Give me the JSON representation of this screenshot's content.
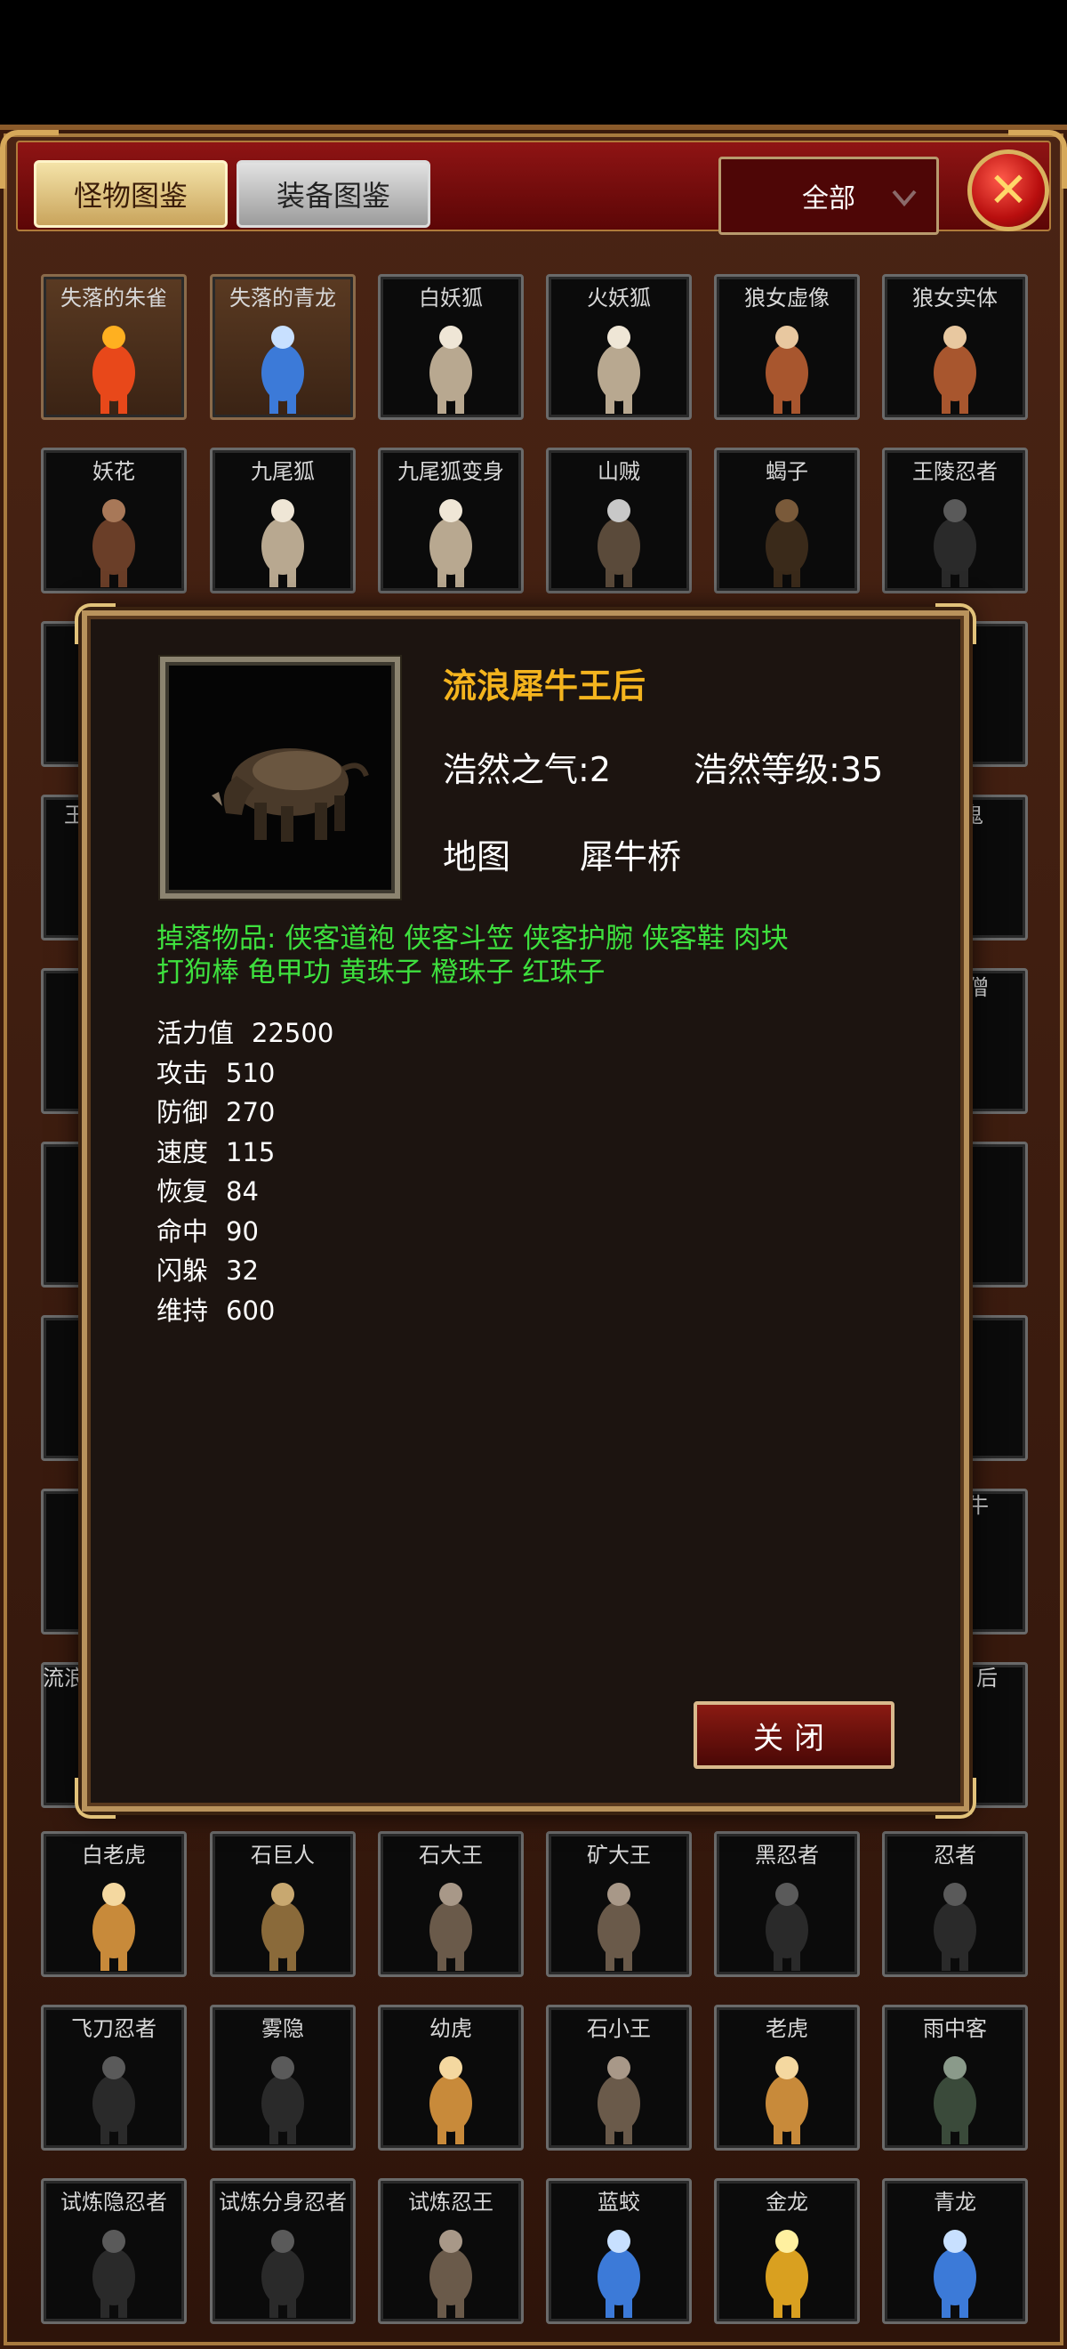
{
  "tabs": {
    "monster_label": "怪物图鉴",
    "equipment_label": "装备图鉴"
  },
  "filter": {
    "selected": "全部"
  },
  "colors": {
    "accent_gold": "#f4b41e",
    "drop_green": "#3ee03e",
    "header_red": "#8f1414"
  },
  "grid_top": [
    [
      {
        "name": "失落的朱雀",
        "icon": "phoenix-sprite",
        "gold": true
      },
      {
        "name": "失落的青龙",
        "icon": "dragon-sprite",
        "gold": true
      },
      {
        "name": "白妖狐",
        "icon": "fox-sprite",
        "gold": false
      },
      {
        "name": "火妖狐",
        "icon": "fox-sprite",
        "gold": false
      },
      {
        "name": "狼女虚像",
        "icon": "wolfgirl-sprite",
        "gold": false
      },
      {
        "name": "狼女实体",
        "icon": "wolfgirl-sprite",
        "gold": false
      }
    ],
    [
      {
        "name": "妖花",
        "icon": "demon-sprite",
        "gold": false
      },
      {
        "name": "九尾狐",
        "icon": "fox-sprite",
        "gold": false
      },
      {
        "name": "九尾狐变身",
        "icon": "fox-sprite",
        "gold": false
      },
      {
        "name": "山贼",
        "icon": "bandit-sprite",
        "gold": false
      },
      {
        "name": "蝎子",
        "icon": "scorpion-sprite",
        "gold": false
      },
      {
        "name": "王陵忍者",
        "icon": "ninja-sprite",
        "gold": false
      }
    ]
  ],
  "grid_bottom": [
    [
      {
        "name": "白老虎",
        "icon": "tiger-sprite",
        "gold": false
      },
      {
        "name": "石巨人",
        "icon": "golem-sprite",
        "gold": false
      },
      {
        "name": "石大王",
        "icon": "warrior-sprite",
        "gold": false
      },
      {
        "name": "矿大王",
        "icon": "warrior-sprite",
        "gold": false
      },
      {
        "name": "黑忍者",
        "icon": "ninja-sprite",
        "gold": false
      },
      {
        "name": "忍者",
        "icon": "ninja-sprite",
        "gold": false
      }
    ],
    [
      {
        "name": "飞刀忍者",
        "icon": "ninja-sprite",
        "gold": false
      },
      {
        "name": "雾隐",
        "icon": "ninja-sprite",
        "gold": false
      },
      {
        "name": "幼虎",
        "icon": "tiger-sprite",
        "gold": false
      },
      {
        "name": "石小王",
        "icon": "warrior-sprite",
        "gold": false
      },
      {
        "name": "老虎",
        "icon": "tiger-sprite",
        "gold": false
      },
      {
        "name": "雨中客",
        "icon": "swordsman-sprite",
        "gold": false
      }
    ],
    [
      {
        "name": "试炼隐忍者",
        "icon": "ninja-sprite",
        "gold": false
      },
      {
        "name": "试炼分身忍者",
        "icon": "ninja-sprite",
        "gold": false
      },
      {
        "name": "试炼忍王",
        "icon": "warrior-sprite",
        "gold": false
      },
      {
        "name": "蓝蛟",
        "icon": "dragon-sprite",
        "gold": false
      },
      {
        "name": "金龙",
        "icon": "golden-dragon-sprite",
        "gold": false
      },
      {
        "name": "青龙",
        "icon": "dragon-sprite",
        "gold": false
      }
    ]
  ],
  "peek_labels": [
    "王",
    "鬼",
    "流浪",
    "后",
    "牛",
    "僧"
  ],
  "detail": {
    "name": "流浪犀牛王后",
    "portrait_icon": "rhino-sprite",
    "haoran_qi_label": "浩然之气:",
    "haoran_qi_value": "2",
    "haoran_level_label": "浩然等级:",
    "haoran_level_value": "35",
    "map_label": "地图",
    "map_value": "犀牛桥",
    "drops_label": "掉落物品:",
    "drops_line1": "侠客道袍 侠客斗笠 侠客护腕 侠客鞋 肉块",
    "drops_line2": "打狗棒 龟甲功 黄珠子 橙珠子 红珠子",
    "attributes": [
      {
        "label": "活力值",
        "value": "22500"
      },
      {
        "label": "攻击",
        "value": "510"
      },
      {
        "label": "防御",
        "value": "270"
      },
      {
        "label": "速度",
        "value": "115"
      },
      {
        "label": "恢复",
        "value": "84"
      },
      {
        "label": "命中",
        "value": "90"
      },
      {
        "label": "闪躲",
        "value": "32"
      },
      {
        "label": "维持",
        "value": "600"
      }
    ],
    "close_label": "关闭"
  }
}
